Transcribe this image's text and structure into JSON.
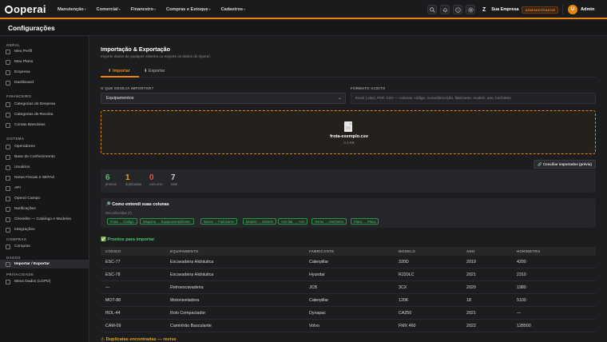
{
  "app": {
    "logo": "operai"
  },
  "nav": [
    {
      "label": "Manutenção"
    },
    {
      "label": "Comercial"
    },
    {
      "label": "Financeiro"
    },
    {
      "label": "Compras e Estoque"
    },
    {
      "label": "Cadastros"
    }
  ],
  "header_right": {
    "company_name": "Sua Empresa",
    "role_badge": "ADMINISTRADOR",
    "avatar_letter": "U",
    "user_name": "Admin",
    "icons": [
      "search-icon",
      "bell-icon",
      "help-icon",
      "gear-icon"
    ]
  },
  "page_title": "Configurações",
  "sidebar": {
    "sections": [
      {
        "title": "GERAL",
        "items": [
          "Meu Perfil",
          "Meu Plano",
          "Empresa",
          "Dashboard"
        ]
      },
      {
        "title": "FINANCEIRO",
        "items": [
          "Categorias de Despesa",
          "Categorias de Receita",
          "Contas Bancárias"
        ]
      },
      {
        "title": "SISTEMA",
        "items": [
          "Operadores",
          "Base de Conhecimento",
          "Usuários",
          "Notas Fiscais e SEFAZ",
          "API",
          "Operaí Campo",
          "Notificações",
          "Checklist — Catálogo e Modelos",
          "Integrações"
        ]
      },
      {
        "title": "COMPRAS",
        "items": [
          "Compras"
        ]
      },
      {
        "title": "DADOS",
        "items": [
          "Importar / Exportar"
        ]
      },
      {
        "title": "PRIVACIDADE",
        "items": [
          "Meus Dados (LGPD)"
        ]
      }
    ],
    "active": "Importar / Exportar"
  },
  "import_export": {
    "title": "Importação & Exportação",
    "subtitle": "Importe dados de qualquer sistema ou exporte os dados do Operaí.",
    "tabs": [
      {
        "label": "⬆ Importar"
      },
      {
        "label": "⬇ Exportar"
      }
    ],
    "what_label": "O QUE DESEJA IMPORTAR?",
    "what_value": "Equipamentos",
    "format_label": "FORMATO ACEITO",
    "format_value": "Excel (.xlsx), PDF, CSV — colunas: código, nome/descrição, fabricante, modelo, ano, horímetro",
    "file_name": "frota-exemplo.csv",
    "file_size": "0.3 KB",
    "reconcile_button": "🔗 Conciliar importados (prévia)"
  },
  "stats": [
    {
      "value": "6",
      "label": "prontos",
      "color": "#53c06f"
    },
    {
      "value": "1",
      "label": "duplicadas",
      "color": "#e8a317"
    },
    {
      "value": "0",
      "label": "com erro",
      "color": "#e5534b"
    },
    {
      "value": "7",
      "label": "total",
      "color": "#cfcfcf"
    }
  ],
  "columns_understood": {
    "title": "🔎 Como entendi suas colunas",
    "recognized": "Reconhecidas (7)",
    "chips": [
      "Frota → Código",
      "Máquina → Equipamento/Nome",
      "Marca → Fabricante",
      "Modelo → Modelo",
      "Ano fab. → Ano",
      "Horas → Horímetro",
      "Placa → Placa"
    ]
  },
  "ready_title": "✅ Prontos para importar",
  "table": {
    "headers": [
      "CÓDIGO",
      "EQUIPAMENTO",
      "FABRICANTE",
      "MODELO",
      "ANO",
      "HORÍMETRO"
    ],
    "rows": [
      [
        "ESC-77",
        "Escavadeira Hidráulica",
        "Caterpillar",
        "320D",
        "2019",
        "4200"
      ],
      [
        "ESC-78",
        "Escavadeira Hidráulica",
        "Hyundai",
        "R220LC",
        "2021",
        "2310"
      ],
      [
        "—",
        "Retroescavadeira",
        "JCB",
        "3CX",
        "2020",
        "1980"
      ],
      [
        "MOT-88",
        "Motoniveladora",
        "Caterpillar",
        "120K",
        "18",
        "5100"
      ],
      [
        "ROL-44",
        "Rolo Compactador",
        "Dynapac",
        "CA250",
        "2021",
        "—"
      ],
      [
        "CAM-09",
        "Caminhão Basculante",
        "Volvo",
        "FMX 460",
        "2022",
        "128500"
      ]
    ]
  },
  "duplicates_title": "⚠ Duplicatas encontradas — revise"
}
